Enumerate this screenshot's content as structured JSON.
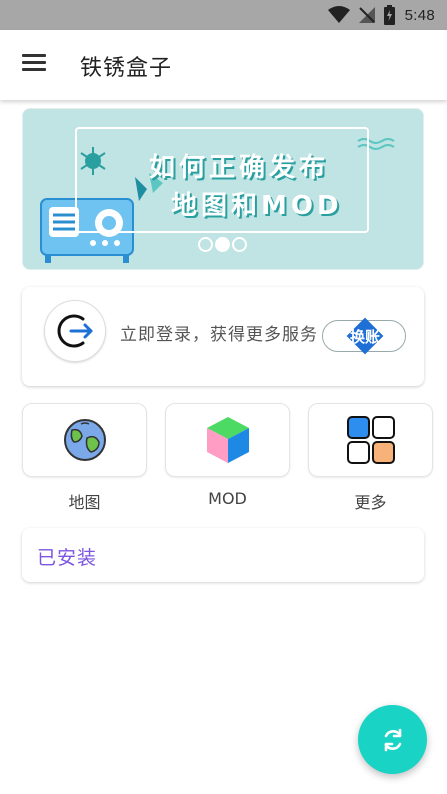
{
  "status_bar": {
    "time": "5:48",
    "icons": [
      "wifi-icon",
      "no-signal-icon",
      "battery-charging-icon"
    ]
  },
  "app_bar": {
    "title": "铁锈盒子",
    "menu_icon": "hamburger-menu-icon"
  },
  "banner": {
    "line1": "如何正确发布",
    "line2": "地图和MOD",
    "dot_count": 3,
    "active_dot": 1,
    "background": "#bfe4e3"
  },
  "login": {
    "text": "立即登录，获得更多服务",
    "switch_label": "换账",
    "icon": "login-arrow-icon"
  },
  "quick_actions": [
    {
      "label": "地图",
      "icon": "globe-icon"
    },
    {
      "label": "MOD",
      "icon": "cube-icon"
    },
    {
      "label": "更多",
      "icon": "grid-icon"
    }
  ],
  "installed": {
    "label": "已安装",
    "color": "#7c55e0"
  },
  "fab": {
    "icon": "refresh-icon",
    "color": "#19d3c5"
  }
}
